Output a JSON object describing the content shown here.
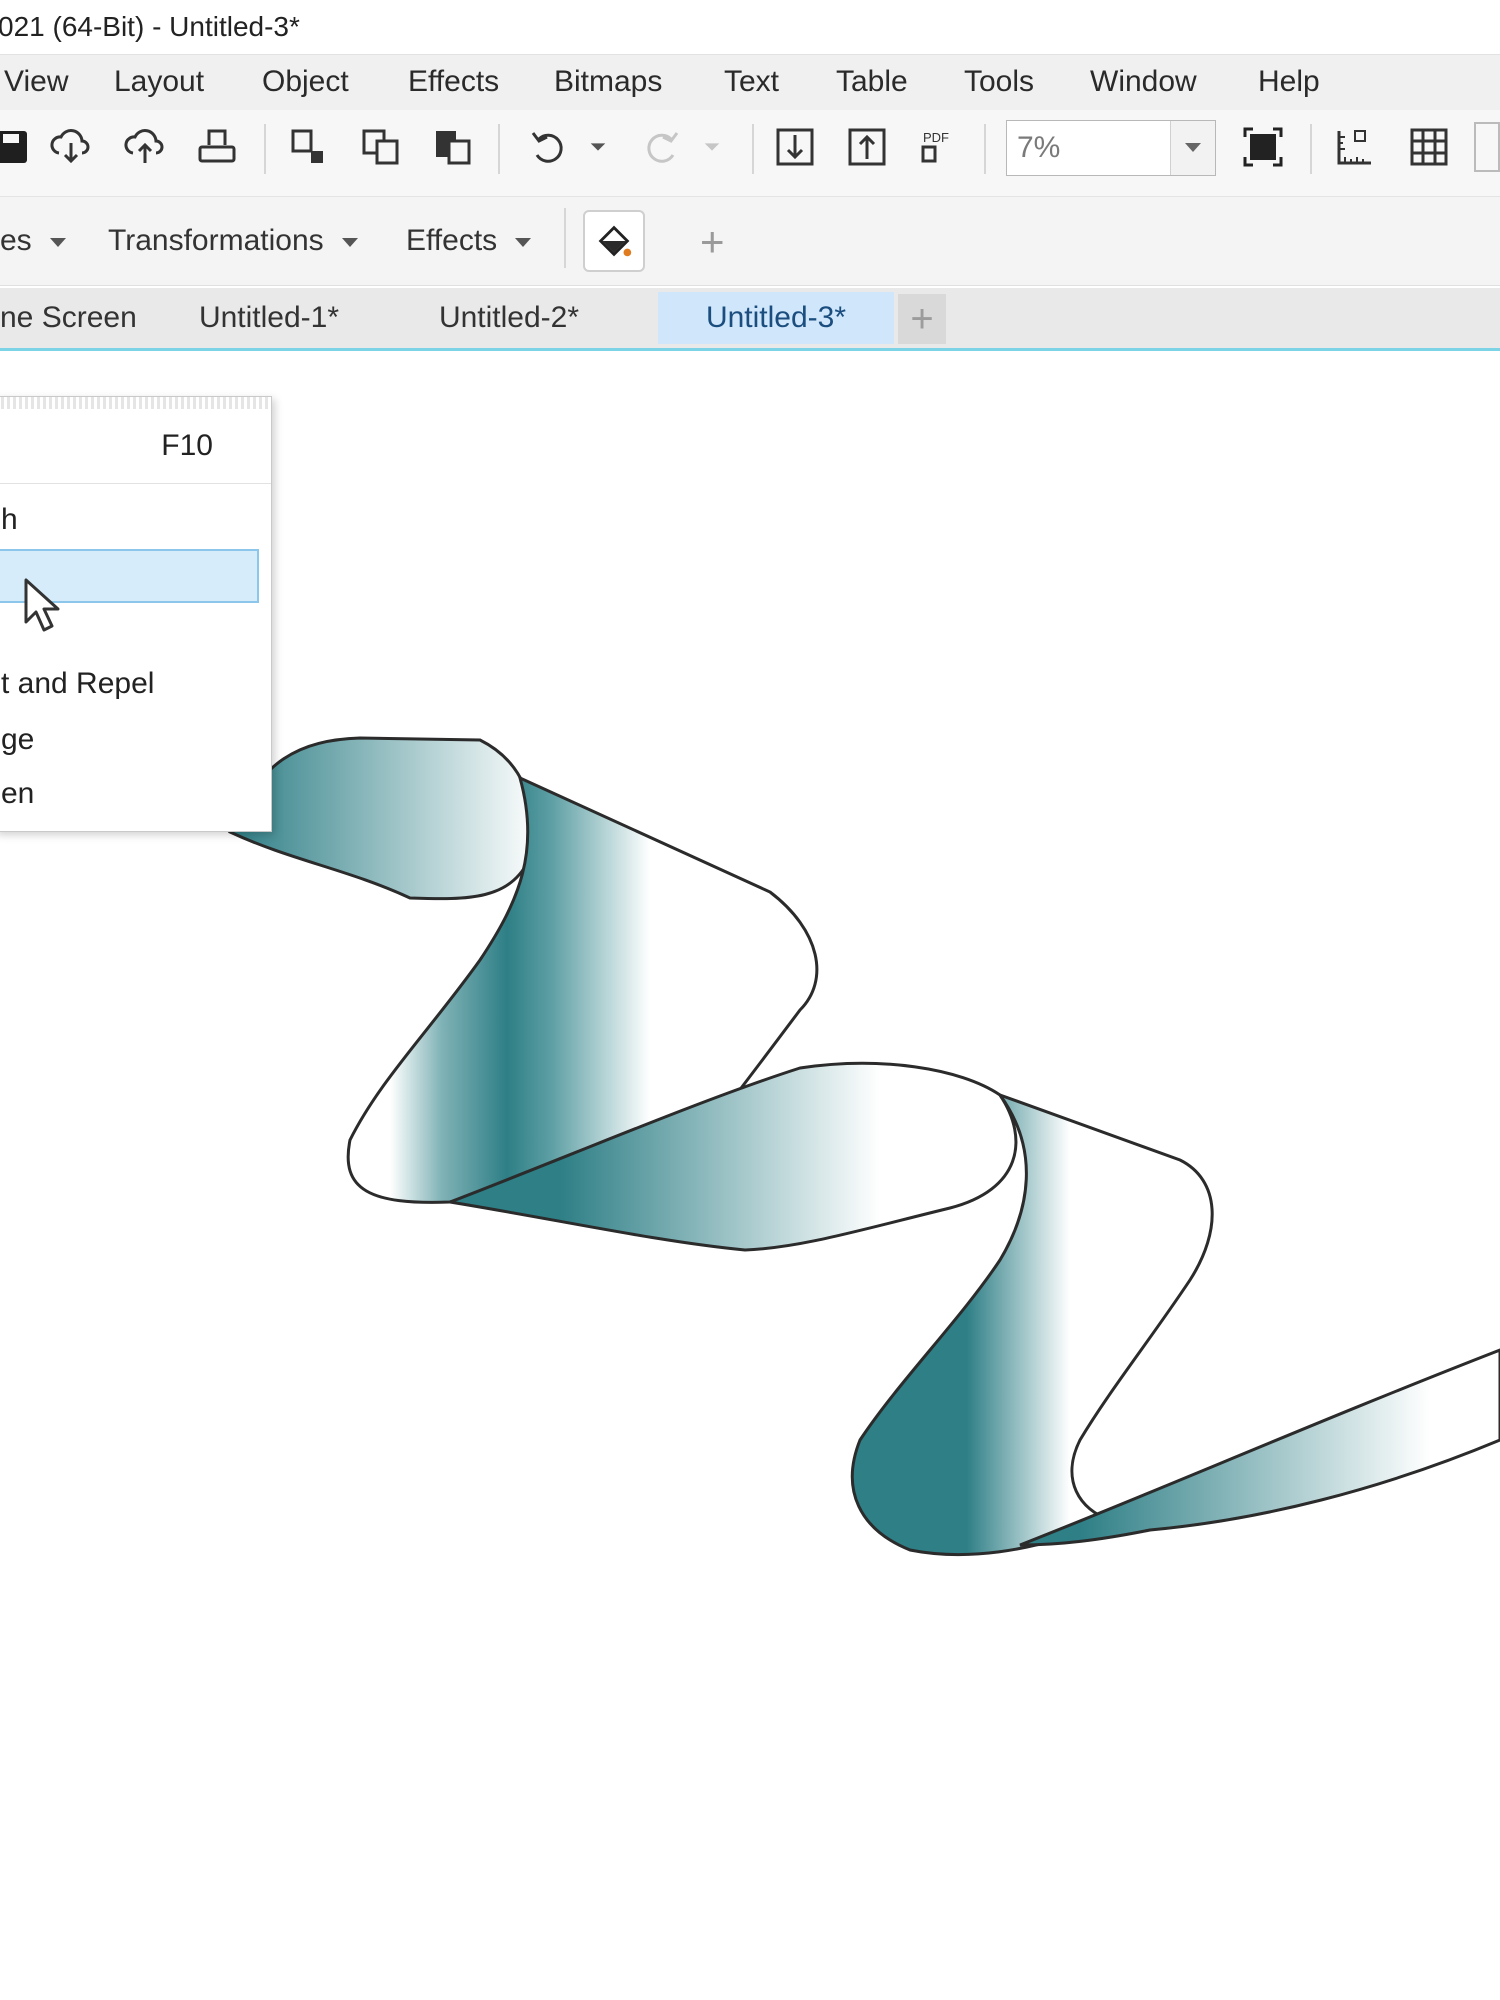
{
  "window": {
    "title": "021 (64-Bit) - Untitled-3*"
  },
  "menubar": {
    "items": [
      "View",
      "Layout",
      "Object",
      "Effects",
      "Bitmaps",
      "Text",
      "Table",
      "Tools",
      "Window",
      "Help"
    ]
  },
  "toolbar": {
    "icons": [
      "save-icon",
      "cloud-download-icon",
      "cloud-upload-icon",
      "print-icon",
      "cut-icon",
      "copy-icon",
      "paste-icon",
      "undo-icon",
      "redo-icon",
      "import-icon",
      "export-icon",
      "pdf-icon",
      "full-screen-icon",
      "rulers-icon",
      "grid-icon"
    ],
    "pdf_label": "PDF",
    "zoom_value": "7%"
  },
  "propbar": {
    "items": [
      {
        "label": "es",
        "has_dropdown": true
      },
      {
        "label": "Transformations",
        "has_dropdown": true
      },
      {
        "label": "Effects",
        "has_dropdown": true
      }
    ],
    "add_label": "+"
  },
  "tabs": [
    {
      "label": "ne Screen",
      "active": false
    },
    {
      "label": "Untitled-1*",
      "active": false
    },
    {
      "label": "Untitled-2*",
      "active": false
    },
    {
      "label": "Untitled-3*",
      "active": true
    }
  ],
  "tab_add_label": "+",
  "context_menu": {
    "items": [
      {
        "label": "",
        "shortcut": "F10"
      },
      {
        "label": "h",
        "shortcut": ""
      },
      {
        "label": "",
        "shortcut": "",
        "highlighted": true
      },
      {
        "label": "t and Repel",
        "shortcut": ""
      },
      {
        "label": "ge",
        "shortcut": ""
      },
      {
        "label": "en",
        "shortcut": ""
      }
    ]
  },
  "colors": {
    "ribbon_dark": "#2e7f86",
    "ribbon_light": "#ffffff",
    "tab_active": "#cfe6fb",
    "tab_underline": "#7dd3e6",
    "menu_highlight": "#d6ecfb"
  }
}
